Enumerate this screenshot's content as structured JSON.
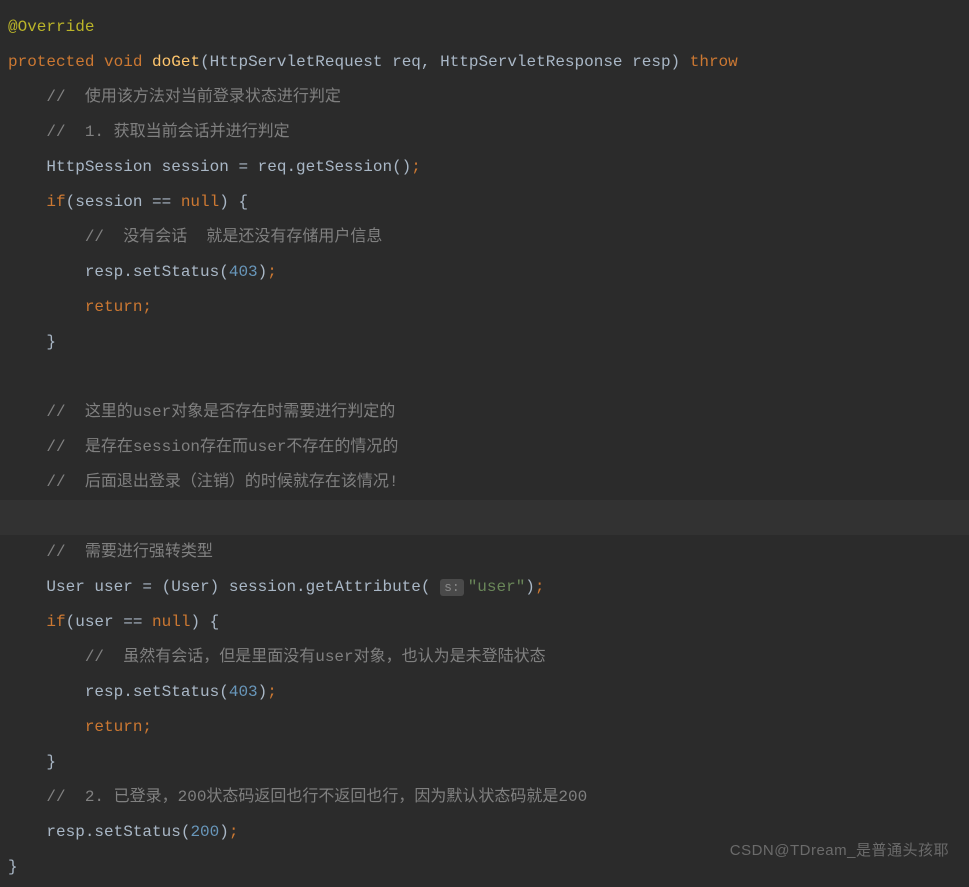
{
  "code": {
    "line1_annotation": "@Override",
    "line2_kw_protected": "protected",
    "line2_kw_void": "void",
    "line2_method": "doGet",
    "line2_params": "(HttpServletRequest req, HttpServletResponse resp) ",
    "line2_kw_throws": "throw",
    "line3_comment": "//  使用该方法对当前登录状态进行判定",
    "line4_comment": "//  1. 获取当前会话并进行判定",
    "line5_type": "HttpSession session = req.getSession()",
    "line5_semi": ";",
    "line6_kw_if": "if",
    "line6_cond_a": "(session == ",
    "line6_kw_null": "null",
    "line6_cond_b": ") {",
    "line7_comment": "//  没有会话  就是还没有存储用户信息",
    "line8_call": "resp.setStatus(",
    "line8_num": "403",
    "line8_end": ")",
    "line8_semi": ";",
    "line9_kw_return": "return",
    "line9_semi": ";",
    "line10_brace": "}",
    "line12_comment": "//  这里的user对象是否存在时需要进行判定的",
    "line13_comment": "//  是存在session存在而user不存在的情况的",
    "line14_comment": "//  后面退出登录（注销）的时候就存在该情况!",
    "line16_comment": "//  需要进行强转类型",
    "line17_a": "User user = (User) session.getAttribute(",
    "line17_hint": "s:",
    "line17_str": "\"user\"",
    "line17_b": ")",
    "line17_semi": ";",
    "line18_kw_if": "if",
    "line18_cond_a": "(user == ",
    "line18_kw_null": "null",
    "line18_cond_b": ") {",
    "line19_comment": "//  虽然有会话，但是里面没有user对象，也认为是未登陆状态",
    "line20_call": "resp.setStatus(",
    "line20_num": "403",
    "line20_end": ")",
    "line20_semi": ";",
    "line21_kw_return": "return",
    "line21_semi": ";",
    "line22_brace": "}",
    "line23_comment": "//  2. 已登录，200状态码返回也行不返回也行，因为默认状态码就是200",
    "line24_call": "resp.setStatus(",
    "line24_num": "200",
    "line24_end": ")",
    "line24_semi": ";",
    "line25_brace": "}"
  },
  "watermark": "CSDN@TDream_是普通头孩耶"
}
